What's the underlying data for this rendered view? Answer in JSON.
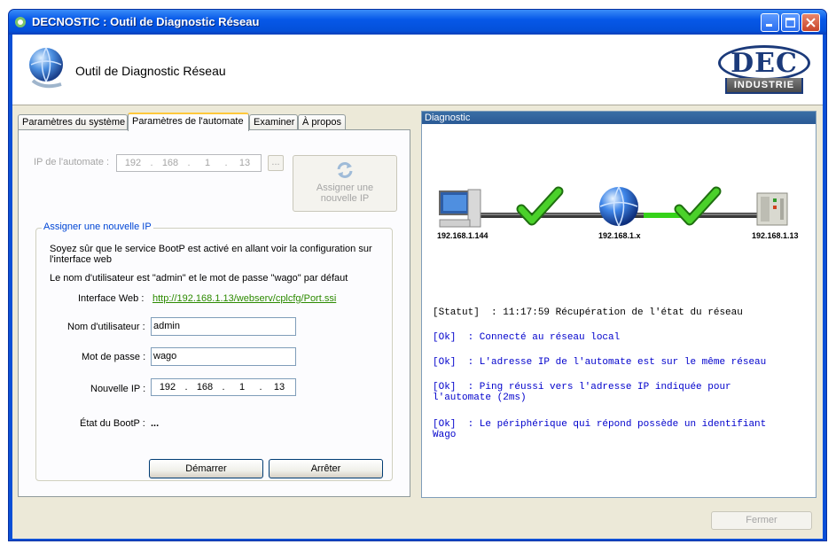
{
  "window": {
    "title": "DECNOSTIC : Outil de Diagnostic Réseau"
  },
  "header": {
    "title": "Outil de Diagnostic Réseau",
    "logo_top": "DEC",
    "logo_band": "INDUSTRIE"
  },
  "tabs": [
    {
      "label": "Paramètres du système",
      "active": false
    },
    {
      "label": "Paramètres de l'automate",
      "active": true
    },
    {
      "label": "Examiner",
      "active": false
    },
    {
      "label": "À propos",
      "active": false
    }
  ],
  "automate": {
    "ip_label": "IP de l'automate :",
    "ip": [
      "192",
      "168",
      "1",
      "13"
    ],
    "browse_label": "...",
    "assign_button": "Assigner une nouvelle IP"
  },
  "new_ip": {
    "legend": "Assigner une nouvelle IP",
    "info_line1": "Soyez sûr que le service BootP est activé en allant voir la configuration sur l'interface web",
    "info_line2": "Le nom d'utilisateur est \"admin\" et le mot de passe \"wago\" par défaut",
    "web_label": "Interface Web :",
    "web_url": "http://192.168.1.13/webserv/cplcfg/Port.ssi",
    "user_label": "Nom d'utilisateur :",
    "user_value": "admin",
    "pass_label": "Mot de passe :",
    "pass_value": "wago",
    "newip_label": "Nouvelle IP :",
    "new_ip": [
      "192",
      "168",
      "1",
      "13"
    ],
    "bootp_label": "État du BootP :",
    "bootp_value": "...",
    "start_button": "Démarrer",
    "stop_button": "Arrêter"
  },
  "diagnostic": {
    "title": "Diagnostic",
    "nodes": {
      "pc": "192.168.1.144",
      "network": "192.168.1.x",
      "plc": "192.168.1.13"
    },
    "log": [
      {
        "type": "status",
        "text": "[Statut]  : 11:17:59 Récupération de l'état du réseau"
      },
      {
        "type": "ok",
        "text": "[Ok]  : Connecté au réseau local"
      },
      {
        "type": "ok",
        "text": "[Ok]  : L'adresse IP de l'automate est sur le même réseau"
      },
      {
        "type": "ok",
        "text": "[Ok]  : Ping réussi vers l'adresse IP indiquée pour\nl'automate (2ms)"
      },
      {
        "type": "ok",
        "text": "[Ok]  : Le périphérique qui répond possède un identifiant\nWago"
      }
    ]
  },
  "footer": {
    "close_button": "Fermer"
  },
  "colors": {
    "title_bar": "#0658e8",
    "link": "#2c8a00",
    "ok_text": "#0000cc",
    "check": "#3fbf1f",
    "legend": "#0046d5"
  }
}
